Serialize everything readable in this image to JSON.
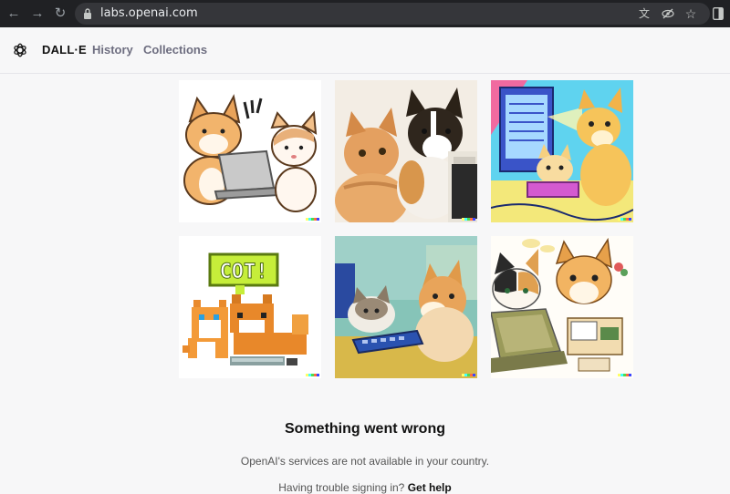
{
  "browser": {
    "url": "labs.openai.com",
    "icons": [
      "back-icon",
      "forward-icon",
      "reload-icon",
      "lock-icon",
      "translate-icon",
      "tracking-off-icon",
      "star-icon",
      "sidebar-icon"
    ]
  },
  "header": {
    "brand": "DALL·E",
    "nav": [
      "History",
      "Collections"
    ]
  },
  "gallery": {
    "tiles": [
      {
        "subject": "cartoon corgi and cat at laptop"
      },
      {
        "subject": "photo cat and corgi at computer"
      },
      {
        "subject": "colorful dog and cat at computer"
      },
      {
        "subject": "pixel art cat and corgi with COT! bubble",
        "bubble": "COT!"
      },
      {
        "subject": "painting cat and corgi at keyboard"
      },
      {
        "subject": "watercolor cat and corgi at laptop"
      }
    ]
  },
  "message": {
    "title": "Something went wrong",
    "text": "OpenAI's services are not available in your country.",
    "help_prefix": "Having trouble signing in?",
    "help_link": "Get help"
  },
  "colors": {
    "chrome_bg": "#202124",
    "page_bg": "#f7f7f8",
    "signature": [
      "#ffff66",
      "#42ffff",
      "#51da4c",
      "#ff6e3c",
      "#3c46ff"
    ]
  }
}
